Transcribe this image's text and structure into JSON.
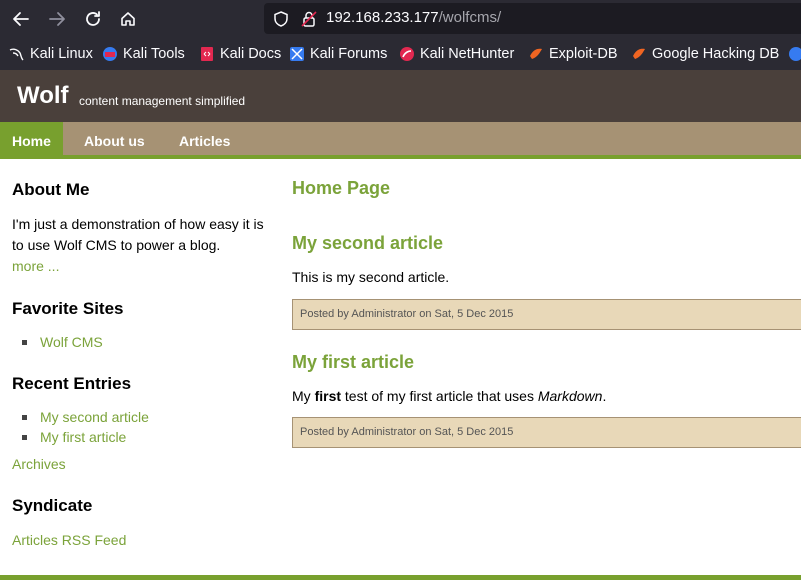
{
  "browser": {
    "url_host": "192.168.233.177",
    "url_path": "/wolfcms/",
    "bookmarks": [
      {
        "label": "Kali Linux",
        "icon": "kali-dragon-icon"
      },
      {
        "label": "Kali Tools",
        "icon": "kali-tools-icon"
      },
      {
        "label": "Kali Docs",
        "icon": "kali-docs-icon"
      },
      {
        "label": "Kali Forums",
        "icon": "kali-forums-icon"
      },
      {
        "label": "Kali NetHunter",
        "icon": "nethunter-icon"
      },
      {
        "label": "Exploit-DB",
        "icon": "exploit-db-icon"
      },
      {
        "label": "Google Hacking DB",
        "icon": "ghdb-icon"
      }
    ]
  },
  "site": {
    "logo": "Wolf",
    "slogan": "content management simplified",
    "nav": [
      "Home",
      "About us",
      "Articles"
    ]
  },
  "sidebar": {
    "about_heading": "About Me",
    "about_text": "I'm just a demonstration of how easy it is to use Wolf CMS to power a blog.",
    "about_more": "more ...",
    "favorites_heading": "Favorite Sites",
    "favorites": [
      "Wolf CMS"
    ],
    "recent_heading": "Recent Entries",
    "recent": [
      "My second article",
      "My first article"
    ],
    "archives": "Archives",
    "syndicate_heading": "Syndicate",
    "rss": "Articles RSS Feed"
  },
  "content": {
    "page_title": "Home Page",
    "articles": [
      {
        "title": "My second article",
        "body": "This is my second article.",
        "posted": "Posted by Administrator on Sat, 5 Dec 2015"
      },
      {
        "title": "My first article",
        "body_pre": "My ",
        "body_bold": "first",
        "body_mid": " test of my first article that uses ",
        "body_italic": "Markdown",
        "body_post": ".",
        "posted": "Posted by Administrator on Sat, 5 Dec 2015"
      }
    ]
  },
  "colors": {
    "accent": "#7ba33a",
    "header": "#4a403b",
    "nav": "#a69274",
    "posted_bg": "#e8d8b8"
  }
}
